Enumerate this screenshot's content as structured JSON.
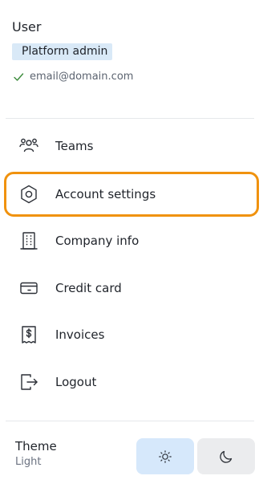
{
  "user": {
    "name": "User",
    "role": "Platform admin",
    "email": "email@domain.com"
  },
  "menu": {
    "items": [
      {
        "label": "Teams",
        "icon": "teams-icon"
      },
      {
        "label": "Account settings",
        "icon": "hexagon-settings-icon",
        "highlighted": true
      },
      {
        "label": "Company info",
        "icon": "building-icon"
      },
      {
        "label": "Credit card",
        "icon": "credit-card-icon"
      },
      {
        "label": "Invoices",
        "icon": "receipt-dollar-icon"
      },
      {
        "label": "Logout",
        "icon": "logout-icon"
      }
    ]
  },
  "theme": {
    "title": "Theme",
    "value": "Light",
    "options": [
      "light",
      "dark"
    ],
    "selected": "light"
  },
  "colors": {
    "highlight_border": "#f0920e",
    "badge_bg": "#d9e9f7",
    "check": "#3a8a3a",
    "theme_selected_bg": "#d6e8fb",
    "theme_unselected_bg": "#ebecee"
  }
}
